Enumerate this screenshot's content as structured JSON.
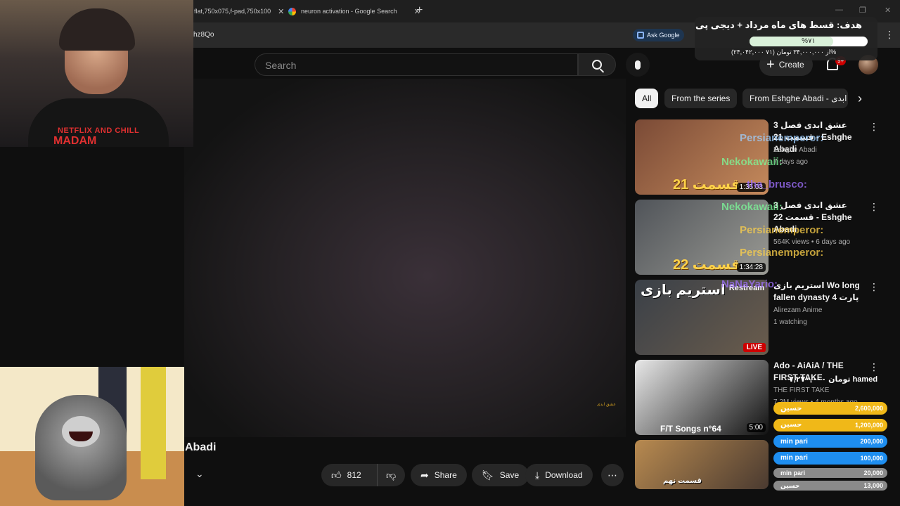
{
  "browser": {
    "tabs": [
      {
        "title": "flat,750x075,f-pad,750x100"
      },
      {
        "title": "neuron activation - Google Search"
      }
    ],
    "url_fragment": "hz8Qo",
    "ask_google_label": "Ask Google"
  },
  "goal": {
    "title": "هدف: قسط های ماه مرداد + دیجی پی",
    "percent_label": "%۷۱",
    "progress": 0.71,
    "amount_text": "(۲۴,۰۴۲,۰۰۰ از ۳۴,۰۰۰,۰۰۰ تومان (۷۱%"
  },
  "header": {
    "search_placeholder": "Search",
    "create_label": "Create",
    "notifications_badge": "9+"
  },
  "video": {
    "title_fragment": "Abadi",
    "watermark": "عشق ابدی",
    "actions": {
      "likes": "812",
      "share": "Share",
      "save": "Save",
      "download": "Download"
    }
  },
  "chips": [
    {
      "label": "All",
      "active": true
    },
    {
      "label": "From the series",
      "active": false
    },
    {
      "label": "From Eshghe Abadi - ابدی",
      "active": false
    }
  ],
  "recommendations": [
    {
      "title": "عشق ابدی فصل 3 قسمت 21 - Eshghe Abadi",
      "channel": "Eshghe Abadi",
      "meta": "7 days ago",
      "duration": "1:35:03",
      "thumb_caption": "قسمت 21",
      "thumb_colors": [
        "#7a4a36",
        "#c58a5c"
      ]
    },
    {
      "title": "عشق ابدی فصل 3 قسمت 22 - Eshghe Abadi",
      "channel": "",
      "meta": "564K views • 6 days ago",
      "duration": "1:34:28",
      "thumb_caption": "قسمت 22",
      "thumb_colors": [
        "#505459",
        "#9a9a94"
      ]
    },
    {
      "title": "استریم بازی Wo long fallen dynasty پارت 4",
      "channel": "Alirezam Anime",
      "meta": "1 watching",
      "live_label": "LIVE",
      "overlay_label": "Restream",
      "thumb_caption": "استریم بازی",
      "thumb_colors": [
        "#3a4048",
        "#6a5c4c"
      ]
    },
    {
      "title": "Ado - AiAiA / THE FIRST TAKE",
      "channel": "THE FIRST TAKE",
      "meta": "7.2M views • 4 months ago",
      "duration": "5:00",
      "thumb_caption": "F/T Songs n°64",
      "thumb_colors": [
        "#e8e8e8",
        "#111111"
      ]
    },
    {
      "title": "",
      "channel": "",
      "meta": "",
      "thumb_caption": "قسمت نهم",
      "thumb_colors": [
        "#b88a50",
        "#4a3a30"
      ]
    }
  ],
  "stream_overlay": {
    "webcam_shirt_line1": "NETFLIX AND CHILL",
    "webcam_shirt_line2": "MADAM",
    "donor_header": "۷,۲۷۰,۰۰۰ تومان hamed",
    "donors": [
      {
        "name": "حسین",
        "amount": "2,600,000",
        "color": "#f0b818"
      },
      {
        "name": "حسین",
        "amount": "1,200,000",
        "color": "#f0b818"
      },
      {
        "name": "min pari",
        "amount": "200,000",
        "color": "#1e8ef0"
      },
      {
        "name": "min pari",
        "amount": "100,000",
        "color": "#1e8ef0"
      },
      {
        "name": "min pari",
        "amount": "20,000",
        "color": "#8a8a8a"
      },
      {
        "name": "حسین",
        "amount": "13,000",
        "color": "#8a8a8a"
      }
    ],
    "chat_fragments": [
      {
        "text": "Persianemperor:",
        "color": "#9fd0ff"
      },
      {
        "text": "Nekokawaii:",
        "color": "#7cfc9a"
      },
      {
        "text": "tha_brusco:",
        "color": "#a070ff"
      },
      {
        "text": "Nekokawaii:",
        "color": "#7cfc9a"
      },
      {
        "text": "Persianemperor:",
        "color": "#ffd24a"
      },
      {
        "text": "Persianemperor:",
        "color": "#ffd24a"
      },
      {
        "text": "NaNaYario:",
        "color": "#a070ff"
      }
    ]
  }
}
